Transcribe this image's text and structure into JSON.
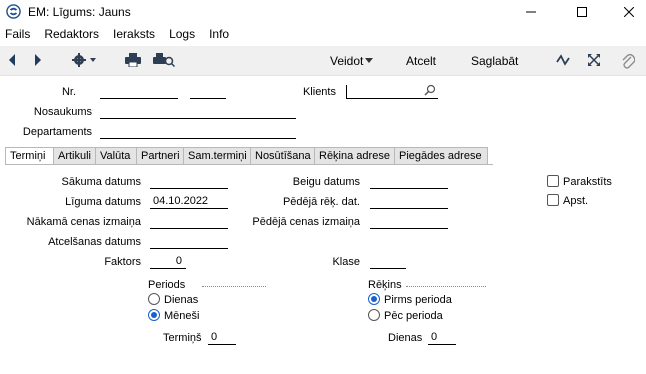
{
  "window": {
    "title": "EM: Līgums: Jauns",
    "minimize_icon": "minimize-icon",
    "maximize_icon": "maximize-icon",
    "close_icon": "close-icon"
  },
  "menu": [
    "Fails",
    "Redaktors",
    "Ieraksts",
    "Logs",
    "Info"
  ],
  "toolbar": {
    "create_label": "Veidot",
    "cancel_label": "Atcelt",
    "save_label": "Saglabāt"
  },
  "header_fields": {
    "nr_label": "Nr.",
    "nr_value": "",
    "nr2_value": "",
    "klients_label": "Klients",
    "klients_value": "",
    "nosaukums_label": "Nosaukums",
    "nosaukums_value": "",
    "departaments_label": "Departaments",
    "departaments_value": ""
  },
  "tabs": [
    "Termiņi",
    "Artikuli",
    "Valūta",
    "Partneri",
    "Sam.termiņi",
    "Nosūtīšana",
    "Rēķina adrese",
    "Piegādes adrese"
  ],
  "terms": {
    "start_label": "Sākuma datums",
    "start_value": "",
    "contract_date_label": "Līguma datums",
    "contract_date_value": "04.10.2022",
    "next_price_label": "Nākamā cenas izmaiņa",
    "next_price_value": "",
    "cancel_date_label": "Atcelšanas datums",
    "cancel_date_value": "",
    "factor_label": "Faktors",
    "factor_value": "0",
    "end_label": "Beigu datums",
    "end_value": "",
    "last_invoice_label": "Pēdējā rēķ. dat.",
    "last_invoice_value": "",
    "last_price_label": "Pēdējā cenas izmaiņa",
    "last_price_value": "",
    "class_label": "Klase",
    "class_value": "",
    "signed_label": "Parakstīts",
    "signed_checked": false,
    "apst_label": "Apst.",
    "apst_checked": false,
    "periods_label": "Periods",
    "period_days_label": "Dienas",
    "period_months_label": "Mēneši",
    "period_selected": "Mēneši",
    "invoice_label": "Rēķins",
    "invoice_before_label": "Pirms perioda",
    "invoice_after_label": "Pēc perioda",
    "invoice_selected": "Pirms perioda",
    "term_label": "Termiņš",
    "term_value": "0",
    "days_label": "Dienas",
    "days_value": "0"
  },
  "colors": {
    "accent": "#1a5fd0",
    "toolbar_bg": "#f0f0f0",
    "tab_bg": "#e4e4e4"
  }
}
